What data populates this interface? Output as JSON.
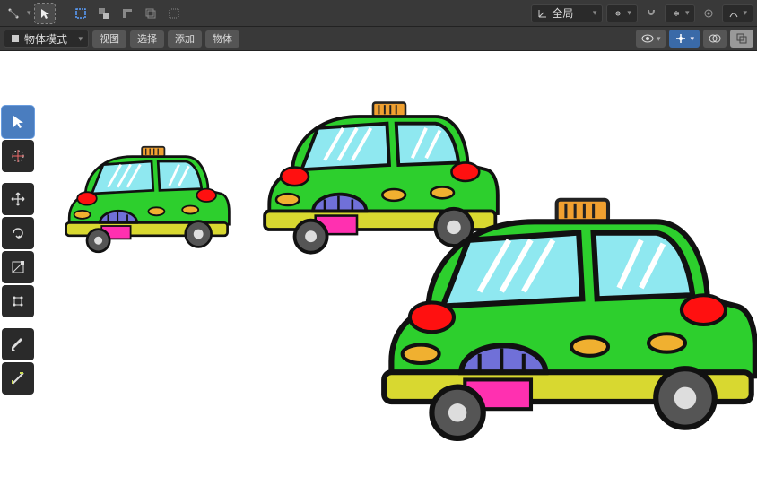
{
  "header": {
    "orientation_label": "全局",
    "mode_label": "物体模式"
  },
  "menu": {
    "view": "视图",
    "select": "选择",
    "add": "添加",
    "object": "物体"
  },
  "tools": {
    "snap": "snap",
    "cursor": "cursor",
    "select_box": "select-box",
    "move": "move",
    "rotate": "rotate",
    "scale": "scale",
    "transform": "transform",
    "annotate": "annotate",
    "measure": "measure"
  },
  "colors": {
    "active": "#4a7dbf",
    "toolbar": "#393939"
  }
}
